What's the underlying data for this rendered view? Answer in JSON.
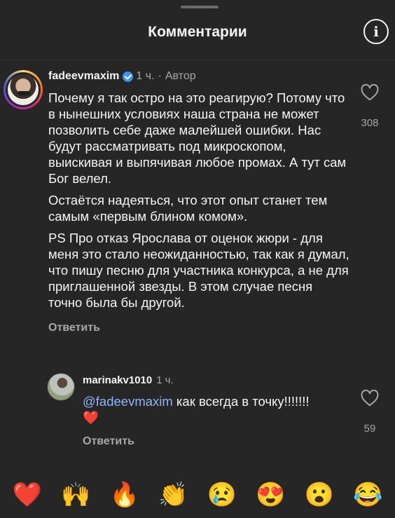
{
  "header": {
    "title": "Комментарии",
    "info_icon": "info-icon"
  },
  "comment1": {
    "username": "fadeevmaxim",
    "time": "1 ч.",
    "separator": "·",
    "author_tag": "Автор",
    "paragraphs": [
      "Почему я так остро на это реагирую? Потому что в нынешних условиях наша страна не может позволить себе даже малейшей ошибки. Нас будут рассматривать под микроскопом, выискивая и выпячивая любое промах. А тут сам Бог велел.",
      "Остаётся надеяться, что этот опыт станет тем самым «первым блином комом».",
      "PS Про отказ Ярослава от оценок жюри - для меня это стало неожиданностью, так как я думал, что пишу песню для участника конкурса, а не для приглашенной звезды. В этом случае песня точно была бы другой."
    ],
    "reply_label": "Ответить",
    "likes": "308"
  },
  "comment2": {
    "username": "marinakv1010",
    "time": "1 ч.",
    "mention": "@fadeevmaxim",
    "text": " как всегда в точку!!!!!!!",
    "emoji": "❤️",
    "reply_label": "Ответить",
    "likes": "59"
  },
  "emoji_bar": [
    "❤️",
    "🙌",
    "🔥",
    "👏",
    "😢",
    "😍",
    "😮",
    "😂"
  ]
}
